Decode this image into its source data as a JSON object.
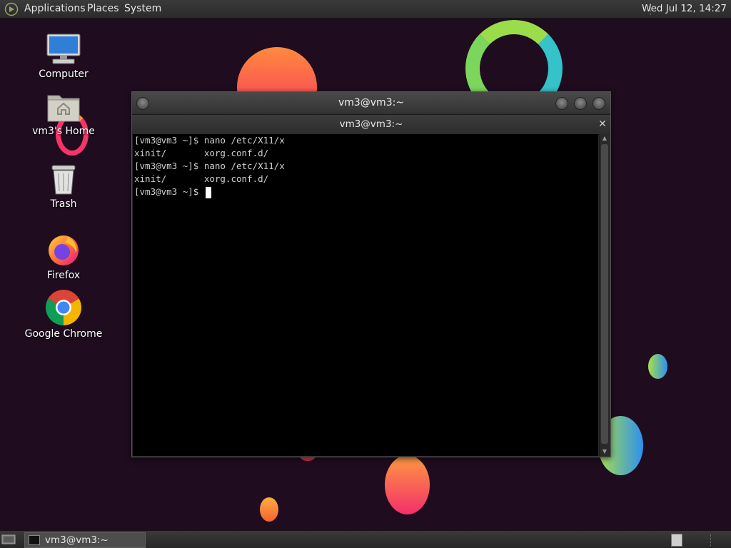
{
  "top_panel": {
    "menus": [
      "Applications",
      "Places",
      "System"
    ],
    "clock": "Wed Jul 12, 14:27"
  },
  "desktop": {
    "icons": [
      {
        "label": "Computer",
        "icon": "computer-icon"
      },
      {
        "label": "vm3's Home",
        "icon": "home-folder-icon"
      },
      {
        "label": "Trash",
        "icon": "trash-icon"
      },
      {
        "label": "Firefox",
        "icon": "firefox-icon"
      },
      {
        "label": "Google Chrome",
        "icon": "chrome-icon"
      }
    ]
  },
  "window": {
    "title": "vm3@vm3:~",
    "tab_title": "vm3@vm3:~",
    "terminal_lines": [
      "[vm3@vm3 ~]$ nano /etc/X11/x",
      "xinit/       xorg.conf.d/",
      "[vm3@vm3 ~]$ nano /etc/X11/x",
      "xinit/       xorg.conf.d/",
      "[vm3@vm3 ~]$ "
    ]
  },
  "bottom_panel": {
    "task_label": "vm3@vm3:~"
  },
  "colors": {
    "panel": "#2e2e2e",
    "wallpaper": "#1f0c1f",
    "terminal_bg": "#000000",
    "terminal_fg": "#d0d0d0"
  }
}
